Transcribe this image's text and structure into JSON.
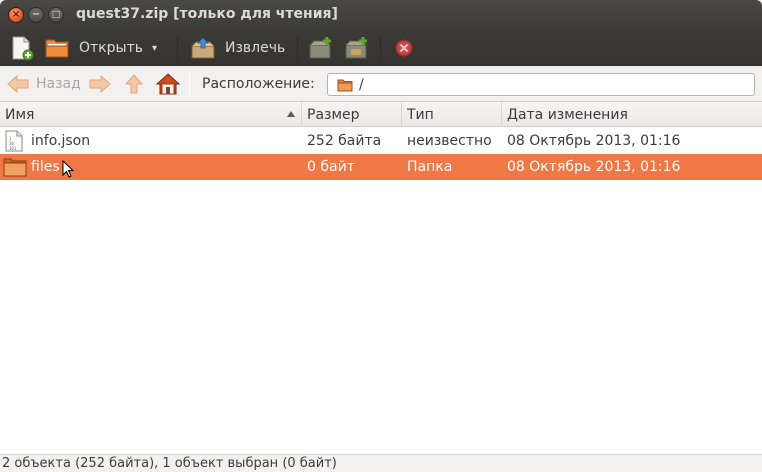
{
  "window": {
    "title": "quest37.zip [только для чтения]",
    "close_glyph": "×",
    "minimize_glyph": "−",
    "maximize_glyph": "□"
  },
  "toolbar": {
    "new_icon": "new-archive-icon",
    "open_label": "Открыть",
    "open_dropdown_glyph": "▾",
    "extract_label": "Извлечь",
    "add_files_icon": "add-files-icon",
    "add_folder_icon": "add-folder-icon",
    "stop_icon": "stop-icon"
  },
  "location": {
    "back_label": "Назад",
    "label": "Расположение:",
    "path": "/"
  },
  "columns": {
    "name": "Имя",
    "size": "Размер",
    "type": "Тип",
    "modified": "Дата изменения"
  },
  "files": [
    {
      "name": "info.json",
      "size": "252 байта",
      "type": "неизвестно",
      "modified": "08 Октябрь 2013, 01:16",
      "icon": "text-file-icon",
      "selected": false
    },
    {
      "name": "files",
      "size": "0 байт",
      "type": "Папка",
      "modified": "08 Октябрь 2013, 01:16",
      "icon": "folder-icon",
      "selected": true
    }
  ],
  "status": {
    "text": "2 объекта (252 байта), 1 объект выбран (0 байт)"
  },
  "colors": {
    "selection": "#f07746",
    "titlebar": "#3c3b37",
    "close_button": "#e4572b"
  }
}
